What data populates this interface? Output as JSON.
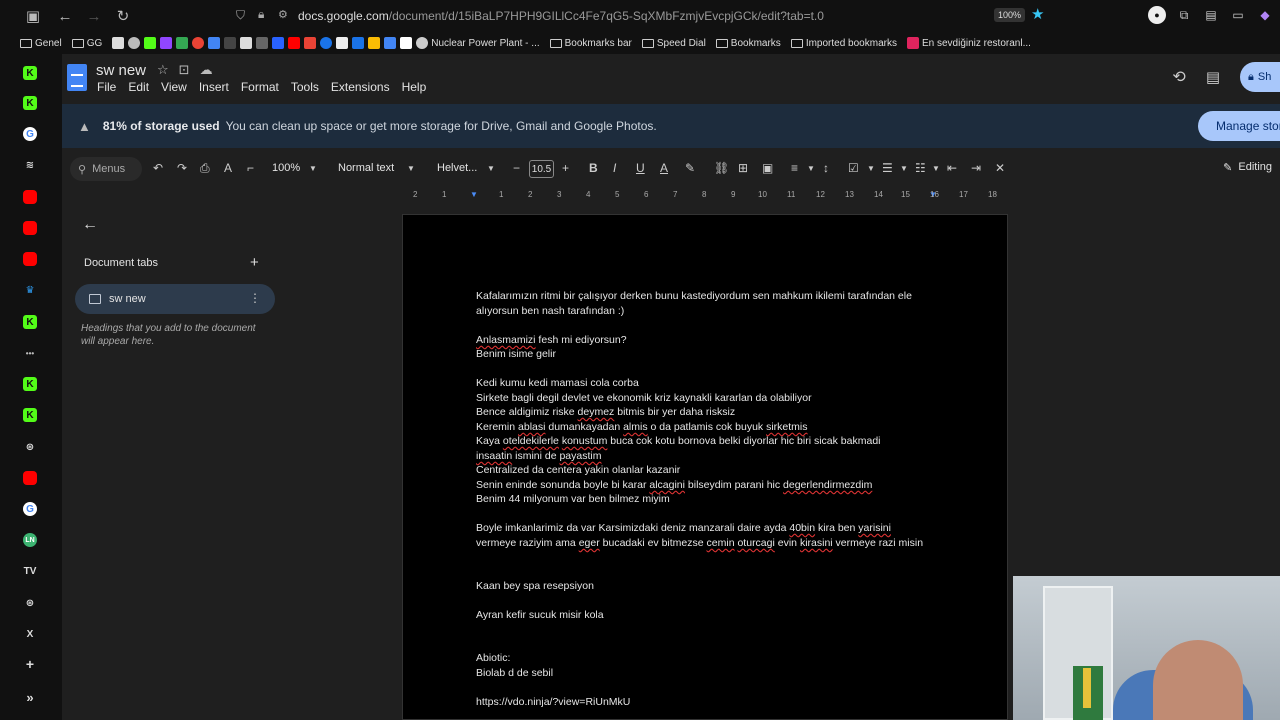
{
  "browser": {
    "url_host": "docs.google.com",
    "url_path": "/document/d/15iBaLP7HPH9GILlCc4Fe7qG5-SqXMbFzmjvEvcpjGCk/edit?tab=t.0",
    "zoom": "100%"
  },
  "bookmarks": [
    {
      "label": "Genel",
      "type": "folder"
    },
    {
      "label": "GG",
      "type": "folder"
    },
    {
      "label": "Nuclear Power Plant - ...",
      "type": "site"
    },
    {
      "label": "Bookmarks bar",
      "type": "folder"
    },
    {
      "label": "Speed Dial",
      "type": "folder"
    },
    {
      "label": "Bookmarks",
      "type": "folder"
    },
    {
      "label": "Imported bookmarks",
      "type": "folder"
    },
    {
      "label": "En sevdiğiniz restoranl...",
      "type": "site"
    }
  ],
  "docs": {
    "title": "sw new",
    "menus": [
      "File",
      "Edit",
      "View",
      "Insert",
      "Format",
      "Tools",
      "Extensions",
      "Help"
    ],
    "share_label": "Sh"
  },
  "banner": {
    "title": "81% of storage used",
    "message": "You can clean up space or get more storage for Drive, Gmail and Google Photos.",
    "button": "Manage stor"
  },
  "toolbar": {
    "search_placeholder": "Menus",
    "zoom": "100%",
    "style": "Normal text",
    "font": "Helvet...",
    "font_size": "10.5",
    "mode": "Editing"
  },
  "ruler": [
    "2",
    "1",
    "1",
    "2",
    "3",
    "4",
    "5",
    "6",
    "7",
    "8",
    "9",
    "10",
    "11",
    "12",
    "13",
    "14",
    "15",
    "16",
    "17",
    "18"
  ],
  "panel": {
    "header": "Document tabs",
    "tab_name": "sw new",
    "hint": "Headings that you add to the document will appear here."
  },
  "content": {
    "lines": [
      [
        {
          "t": "Kafalarımızın ritmi bir çalışıyor derken bunu kastediyordum sen mahkum ikilemi tarafından ele"
        }
      ],
      [
        {
          "t": "alıyorsun ben nash tarafından :)"
        }
      ],
      [
        {
          "t": "Anlasmamizi",
          "s": true
        },
        {
          "t": " fesh mi ediyorsun?"
        }
      ],
      [
        {
          "t": "Benim isime gelir"
        }
      ],
      [
        {
          "t": "Kedi kumu kedi mamasi cola corba"
        }
      ],
      [
        {
          "t": "Sirkete bagli degil devlet ve ekonomik kriz  kaynakli kararlan da olabiliyor"
        }
      ],
      [
        {
          "t": "Bence aldigimiz riske "
        },
        {
          "t": "deymez",
          "s": true
        },
        {
          "t": " bitmis bir yer daha risksiz"
        }
      ],
      [
        {
          "t": "Keremin "
        },
        {
          "t": "ablasi",
          "s": true
        },
        {
          "t": " dumankayadan "
        },
        {
          "t": "almis",
          "s": true
        },
        {
          "t": " o da patlamis cok buyuk "
        },
        {
          "t": "sirketmis",
          "s": true
        }
      ],
      [
        {
          "t": "Kaya "
        },
        {
          "t": "oteldekilerle",
          "s": true
        },
        {
          "t": " "
        },
        {
          "t": "konustum",
          "s": true
        },
        {
          "t": " buca cok kotu bornova belki diyorlar hic biri sicak bakmadi"
        }
      ],
      [
        {
          "t": "insaatin",
          "s": true
        },
        {
          "t": " ismini de "
        },
        {
          "t": "payastim",
          "s": true
        }
      ],
      [
        {
          "t": "Centralized da centera yakin olanlar kazanir"
        }
      ],
      [
        {
          "t": "Senin eninde sonunda boyle bi karar "
        },
        {
          "t": "alcagini",
          "s": true
        },
        {
          "t": " bilseydim parani hic "
        },
        {
          "t": "degerlendirmezdim",
          "s": true
        }
      ],
      [
        {
          "t": "Benim 44 milyonum var ben bilmez miyim"
        }
      ],
      [
        {
          "t": "Boyle imkanlarimiz da var Karsimizdaki deniz manzarali daire ayda "
        },
        {
          "t": "40bin",
          "s": true
        },
        {
          "t": " kira ben "
        },
        {
          "t": "yarisini",
          "s": true
        }
      ],
      [
        {
          "t": "vermeye raziyim ama "
        },
        {
          "t": "eger",
          "s": true
        },
        {
          "t": " bucadaki ev bitmezse "
        },
        {
          "t": "cemin",
          "s": true
        },
        {
          "t": " "
        },
        {
          "t": "oturcagi",
          "s": true
        },
        {
          "t": " evin "
        },
        {
          "t": "kirasini",
          "s": true
        },
        {
          "t": " vermeye razi misin"
        }
      ],
      [
        {
          "t": "Kaan bey spa resepsiyon"
        }
      ],
      [
        {
          "t": "Ayran kefir  sucuk misir kola"
        }
      ],
      [
        {
          "t": "Abiotic:"
        }
      ],
      [
        {
          "t": "Biolab d de sebil"
        }
      ],
      [
        {
          "t": "https://vdo.ninja/?view=RiUnMkU"
        }
      ]
    ]
  }
}
